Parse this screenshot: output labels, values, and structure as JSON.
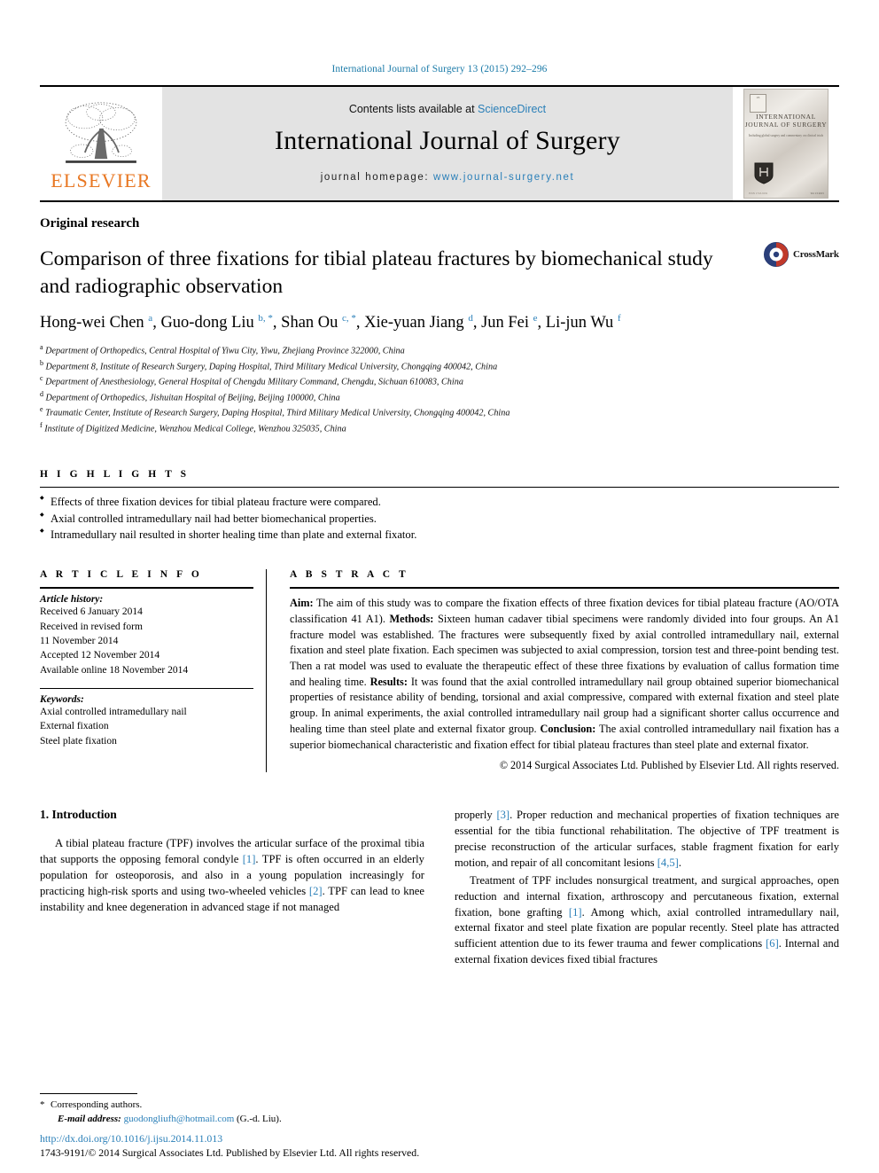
{
  "running_head": "International Journal of Surgery 13 (2015) 292–296",
  "masthead": {
    "publisher_name": "ELSEVIER",
    "contents_prefix": "Contents lists available at",
    "contents_link": "ScienceDirect",
    "journal_title": "International Journal of Surgery",
    "homepage_prefix": "journal homepage:",
    "homepage_url": "www.journal-surgery.net",
    "cover": {
      "title": "INTERNATIONAL JOURNAL OF SURGERY",
      "subtitle": "Including global surgery and commentary on clinical trials",
      "footer_right": "Vol 13 2015",
      "footer_left": "ISSN 1743-9191"
    }
  },
  "article": {
    "kicker": "Original research",
    "title": "Comparison of three fixations for tibial plateau fractures by biomechanical study and radiographic observation",
    "crossmark_label": "CrossMark",
    "authors_html": "Hong-wei Chen <sup>a</sup>, Guo-dong Liu <sup>b, *</sup>, Shan Ou <sup>c, *</sup>, Xie-yuan Jiang <sup>d</sup>, Jun Fei <sup>e</sup>, Li-jun Wu <sup>f</sup>",
    "affiliations": [
      {
        "mark": "a",
        "text": "Department of Orthopedics, Central Hospital of Yiwu City, Yiwu, Zhejiang Province 322000, China"
      },
      {
        "mark": "b",
        "text": "Department 8, Institute of Research Surgery, Daping Hospital, Third Military Medical University, Chongqing 400042, China"
      },
      {
        "mark": "c",
        "text": "Department of Anesthesiology, General Hospital of Chengdu Military Command, Chengdu, Sichuan 610083, China"
      },
      {
        "mark": "d",
        "text": "Department of Orthopedics, Jishuitan Hospital of Beijing, Beijing 100000, China"
      },
      {
        "mark": "e",
        "text": "Traumatic Center, Institute of Research Surgery, Daping Hospital, Third Military Medical University, Chongqing 400042, China"
      },
      {
        "mark": "f",
        "text": "Institute of Digitized Medicine, Wenzhou Medical College, Wenzhou 325035, China"
      }
    ]
  },
  "highlights": {
    "label": "H I G H L I G H T S",
    "items": [
      "Effects of three fixation devices for tibial plateau fracture were compared.",
      "Axial controlled intramedullary nail had better biomechanical properties.",
      "Intramedullary nail resulted in shorter healing time than plate and external fixator."
    ]
  },
  "article_info": {
    "label": "A R T I C L E  I N F O",
    "history_label": "Article history:",
    "history": [
      "Received 6 January 2014",
      "Received in revised form",
      "11 November 2014",
      "Accepted 12 November 2014",
      "Available online 18 November 2014"
    ],
    "keywords_label": "Keywords:",
    "keywords": [
      "Axial controlled intramedullary nail",
      "External fixation",
      "Steel plate fixation"
    ]
  },
  "abstract": {
    "label": "A B S T R A C T",
    "aim_label": "Aim:",
    "aim_text": " The aim of this study was to compare the fixation effects of three fixation devices for tibial plateau fracture (AO/OTA classification 41 A1). ",
    "methods_label": "Methods:",
    "methods_text": " Sixteen human cadaver tibial specimens were randomly divided into four groups. An A1 fracture model was established. The fractures were subsequently fixed by axial controlled intramedullary nail, external fixation and steel plate fixation. Each specimen was subjected to axial compression, torsion test and three-point bending test. Then a rat model was used to evaluate the therapeutic effect of these three fixations by evaluation of callus formation time and healing time. ",
    "results_label": "Results:",
    "results_text": " It was found that the axial controlled intramedullary nail group obtained superior biomechanical properties of resistance ability of bending, torsional and axial compressive, compared with external fixation and steel plate group. In animal experiments, the axial controlled intramedullary nail group had a significant shorter callus occurrence and healing time than steel plate and external fixator group. ",
    "conclusion_label": "Conclusion:",
    "conclusion_text": " The axial controlled intramedullary nail fixation has a superior biomechanical characteristic and fixation effect for tibial plateau fractures than steel plate and external fixator.",
    "copyright": "© 2014 Surgical Associates Ltd. Published by Elsevier Ltd. All rights reserved."
  },
  "body": {
    "section_heading": "1. Introduction",
    "left_paragraphs": [
      "A tibial plateau fracture (TPF) involves the articular surface of the proximal tibia that supports the opposing femoral condyle [1]. TPF is often occurred in an elderly population for osteoporosis, and also in a young population increasingly for practicing high-risk sports and using two-wheeled vehicles [2]. TPF can lead to knee instability and knee degeneration in advanced stage if not managed"
    ],
    "right_paragraphs": [
      "properly [3]. Proper reduction and mechanical properties of fixation techniques are essential for the tibia functional rehabilitation. The objective of TPF treatment is precise reconstruction of the articular surfaces, stable fragment fixation for early motion, and repair of all concomitant lesions [4,5].",
      "Treatment of TPF includes nonsurgical treatment, and surgical approaches, open reduction and internal fixation, arthroscopy and percutaneous fixation, external fixation, bone grafting [1]. Among which, axial controlled intramedullary nail, external fixator and steel plate fixation are popular recently. Steel plate has attracted sufficient attention due to its fewer trauma and fewer complications [6]. Internal and external fixation devices fixed tibial fractures"
    ]
  },
  "footnotes": {
    "corresponding": "Corresponding authors.",
    "email_label": "E-mail address:",
    "email": "guodongliufh@hotmail.com",
    "email_owner": "(G.-d. Liu).",
    "doi": "http://dx.doi.org/10.1016/j.ijsu.2014.11.013",
    "issn_line": "1743-9191/© 2014 Surgical Associates Ltd. Published by Elsevier Ltd. All rights reserved."
  },
  "colors": {
    "link": "#2a7fb8",
    "elsevier_orange": "#E87722",
    "masthead_gray": "#e3e3e3"
  }
}
